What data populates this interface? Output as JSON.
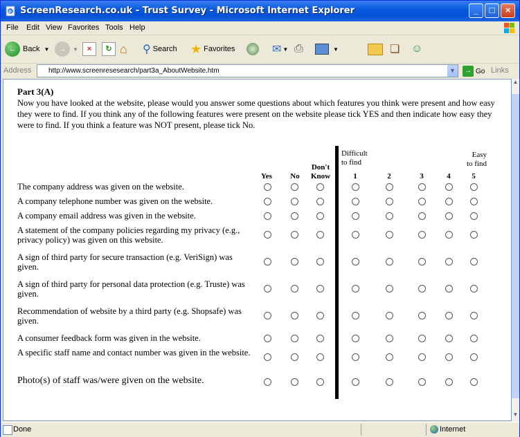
{
  "window": {
    "title": "ScreenResearch.co.uk - Trust Survey - Microsoft Internet Explorer"
  },
  "menu": [
    "File",
    "Edit",
    "View",
    "Favorites",
    "Tools",
    "Help"
  ],
  "toolbar": {
    "back": "Back",
    "search": "Search",
    "favorites": "Favorites"
  },
  "address": {
    "label": "Address",
    "url": "http://www.screenresesearch/part3a_AboutWebsite.htm",
    "go": "Go",
    "links": "Links"
  },
  "status": {
    "text": "Done",
    "zone": "Internet"
  },
  "survey": {
    "part": "Part 3(A)",
    "intro": "Now you have looked at the website, please would you answer some questions about which features you think were present and how easy they were to find. If you think any of the following features were present on the website please tick YES and then indicate how easy they were to find. If you think a feature was NOT present, please tick No.",
    "columns": {
      "yes": "Yes",
      "no": "No",
      "dont1": "Don't",
      "dont2": "Know",
      "difficult1": "Difficult",
      "difficult2": "to find",
      "easy1": "Easy",
      "easy2": "to find",
      "n1": "1",
      "n2": "2",
      "n3": "3",
      "n4": "4",
      "n5": "5"
    },
    "questions": [
      "The company address was given on the website.",
      "A company telephone number was given on the website.",
      "A company email address was given in the website.",
      "A statement of the company policies regarding my privacy (e.g., privacy policy) was given on this website.",
      "A sign of third party for secure transaction (e.g. VeriSign) was given.",
      "A sign of third party for personal data protection (e.g. Truste) was given.",
      "Recommendation of website by a third party (e.g. Shopsafe) was given.",
      "A consumer feedback form was given in the website.",
      "A specific staff name and contact number was given in the website.",
      "Photo(s) of staff was/were given on the website."
    ]
  }
}
